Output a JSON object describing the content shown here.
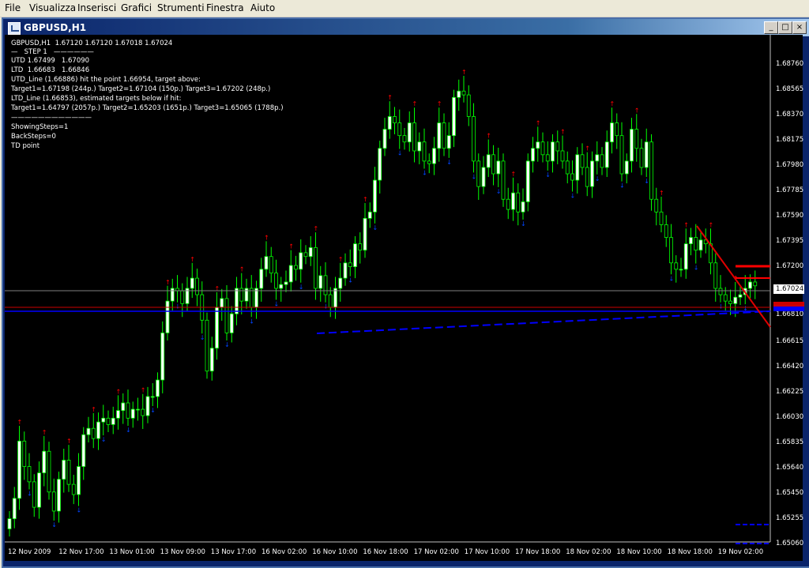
{
  "menu": {
    "items": [
      "File",
      "Visualizza",
      "Inserisci",
      "Grafici",
      "Strumenti",
      "Finestra",
      "Aiuto"
    ]
  },
  "window": {
    "title": "GBPUSD,H1",
    "btn_min": "_",
    "btn_max": "□",
    "btn_close": "×"
  },
  "info": {
    "header": "GBPUSD,H1  1.67120 1.67120 1.67018 1.67024",
    "step": "—   STEP 1   ——————",
    "utd": "UTD 1.67499   1.67090",
    "ltd": "LTD  1.66683   1.66846",
    "utd_line": "UTD_Line (1.66886) hit the point 1.66954, target above:",
    "utd_targets": "Target1=1.67198 (244p.) Target2=1.67104 (150p.) Target3=1.67202 (248p.)",
    "ltd_line": "LTD_Line (1.66853), estimated targets below if hit:",
    "ltd_targets": "Target1=1.64797 (2057p.) Target2=1.65203 (1651p.) Target3=1.65065 (1788p.)",
    "sep": "————————————",
    "showing": "ShowingSteps=1",
    "back": "BackSteps=0",
    "td": "TD point"
  },
  "price_axis": [
    "1.68760",
    "1.68565",
    "1.68370",
    "1.68175",
    "1.67980",
    "1.67785",
    "1.67590",
    "1.67395",
    "1.67200",
    "1.66810",
    "1.66615",
    "1.66420",
    "1.66225",
    "1.66030",
    "1.65835",
    "1.65640",
    "1.65450",
    "1.65255",
    "1.65060"
  ],
  "current_price": "1.67024",
  "time_axis": [
    "12 Nov 2009",
    "12 Nov 17:00",
    "13 Nov 01:00",
    "13 Nov 09:00",
    "13 Nov 17:00",
    "16 Nov 02:00",
    "16 Nov 10:00",
    "16 Nov 18:00",
    "17 Nov 02:00",
    "17 Nov 10:00",
    "17 Nov 18:00",
    "18 Nov 02:00",
    "18 Nov 10:00",
    "18 Nov 18:00",
    "19 Nov 02:00"
  ],
  "chart_data": {
    "type": "candlestick",
    "symbol": "GBPUSD,H1",
    "ylim": [
      1.6502,
      1.6898
    ],
    "closes": [
      1.6519,
      1.6535,
      1.658,
      1.656,
      1.6548,
      1.6528,
      1.6555,
      1.6572,
      1.654,
      1.6525,
      1.655,
      1.6565,
      1.6546,
      1.6538,
      1.656,
      1.6585,
      1.659,
      1.6582,
      1.6595,
      1.6598,
      1.6593,
      1.6598,
      1.6604,
      1.661,
      1.6598,
      1.6605,
      1.6605,
      1.66,
      1.6615,
      1.6615,
      1.6628,
      1.6665,
      1.669,
      1.67,
      1.6698,
      1.6688,
      1.67,
      1.6708,
      1.6695,
      1.6675,
      1.6635,
      1.6653,
      1.6685,
      1.6692,
      1.6665,
      1.668,
      1.67,
      1.669,
      1.67,
      1.6685,
      1.67,
      1.6715,
      1.6725,
      1.6712,
      1.67,
      1.6703,
      1.6705,
      1.6718,
      1.6715,
      1.6728,
      1.6725,
      1.6732,
      1.67,
      1.671,
      1.6695,
      1.6685,
      1.67,
      1.6708,
      1.672,
      1.6717,
      1.6735,
      1.673,
      1.6755,
      1.676,
      1.6785,
      1.681,
      1.6825,
      1.6835,
      1.683,
      1.682,
      1.6815,
      1.683,
      1.6808,
      1.6815,
      1.68,
      1.6798,
      1.681,
      1.683,
      1.681,
      1.682,
      1.685,
      1.6855,
      1.6852,
      1.6835,
      1.68,
      1.678,
      1.6795,
      1.6805,
      1.679,
      1.68,
      1.677,
      1.6762,
      1.6775,
      1.676,
      1.6768,
      1.68,
      1.681,
      1.6815,
      1.6805,
      1.68,
      1.6815,
      1.6808,
      1.68,
      1.679,
      1.6785,
      1.6805,
      1.6795,
      1.678,
      1.68,
      1.6805,
      1.6795,
      1.6815,
      1.683,
      1.682,
      1.679,
      1.68,
      1.6825,
      1.681,
      1.6795,
      1.6815,
      1.677,
      1.676,
      1.675,
      1.674,
      1.672,
      1.6715,
      1.6715,
      1.6735,
      1.674,
      1.673,
      1.6738,
      1.6735,
      1.672,
      1.67,
      1.6695,
      1.669,
      1.6688,
      1.6693,
      1.6695,
      1.67,
      1.6705,
      1.6702
    ]
  }
}
